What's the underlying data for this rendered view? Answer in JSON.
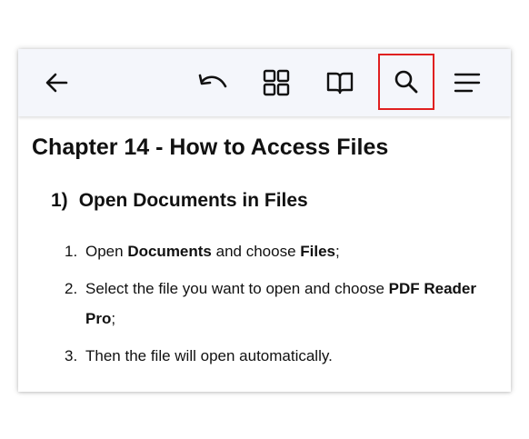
{
  "toolbar": {
    "icons": [
      "back-arrow-icon",
      "undo-icon",
      "grid-icon",
      "book-icon",
      "search-icon",
      "menu-icon"
    ],
    "highlight_color": "#e02020",
    "background": "#f4f6fb"
  },
  "document": {
    "chapter_title": "Chapter 14 - How to Access Files",
    "section_number": "1)",
    "section_title": "Open Documents in Files",
    "steps": [
      {
        "number": "1.",
        "parts": [
          "Open ",
          "Documents",
          " and choose ",
          "Files",
          ";"
        ]
      },
      {
        "number": "2.",
        "parts": [
          "Select the file you want to open and choose ",
          "PDF Reader Pro",
          ";"
        ]
      },
      {
        "number": "3.",
        "parts": [
          "Then the file will open automatically."
        ]
      }
    ]
  }
}
